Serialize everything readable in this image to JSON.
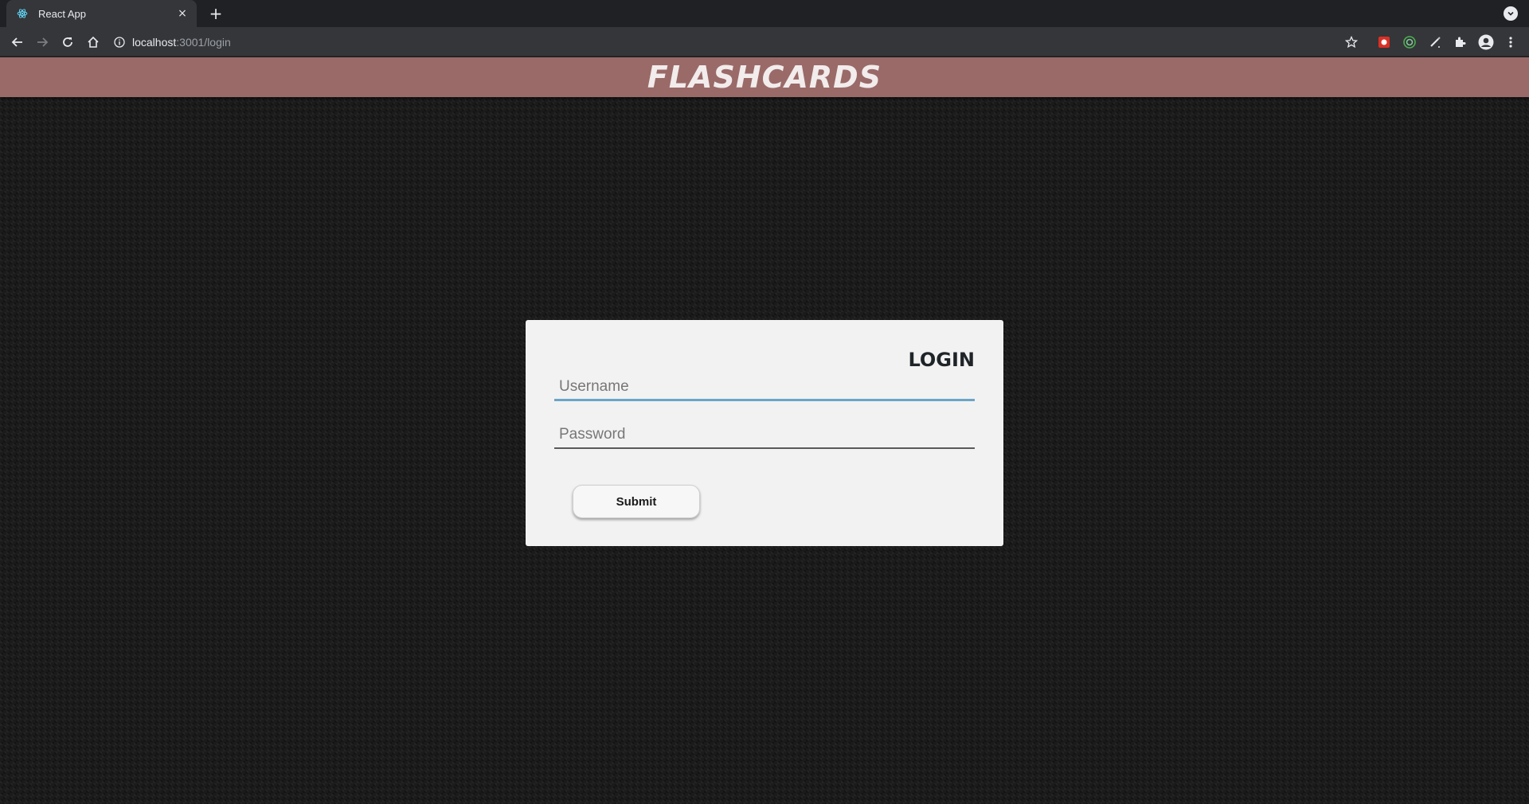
{
  "browser": {
    "tab": {
      "title": "React App",
      "favicon": "react-icon",
      "close": "×"
    },
    "new_tab": "+",
    "url": {
      "host": "localhost",
      "path": ":3001/login"
    }
  },
  "app": {
    "title": "FLASHCARDS",
    "header_color": "#9a6a68"
  },
  "login": {
    "title": "LOGIN",
    "username_placeholder": "Username",
    "password_placeholder": "Password",
    "submit_label": "Submit",
    "focus_color": "#6aa6c8"
  }
}
